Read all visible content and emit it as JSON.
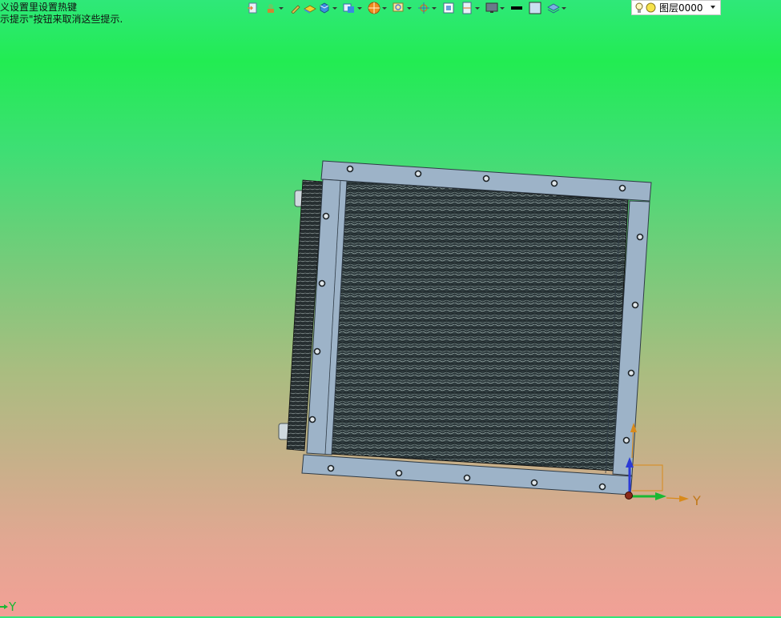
{
  "hints": {
    "line1": "义设置里设置热键",
    "line2": "示提示\"按钮来取消这些提示."
  },
  "toolbar": {
    "icons": [
      "import-icon",
      "part-icon",
      "pencil-icon",
      "block-icon",
      "cube-icon",
      "view-cube-icon",
      "render-icon",
      "zoom-icon",
      "snap-icon",
      "frame-icon",
      "section-icon",
      "display-icon",
      "line-color-swatch",
      "fill-color-swatch",
      "layer-stack-icon"
    ],
    "layer": {
      "name": "图层0000"
    }
  },
  "triad": {
    "y_label": "Y"
  },
  "corner_axis": {
    "y_label": "Y"
  },
  "colors": {
    "frame": "#9db3c8",
    "frame_edge": "#2f3b46",
    "triad_x": "#2b3ad6",
    "triad_y": "#19b833",
    "triad_z": "#d88a1b",
    "triad_label": "#c07818"
  }
}
